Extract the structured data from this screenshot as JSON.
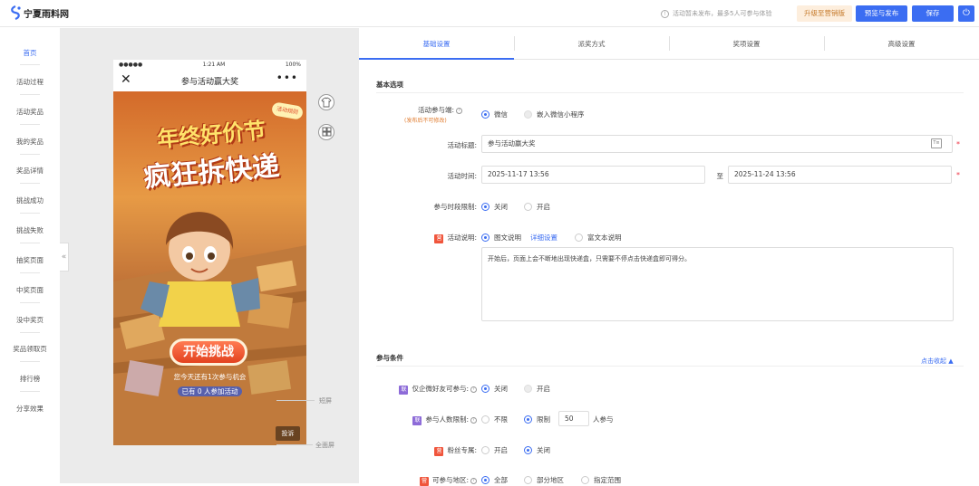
{
  "header": {
    "logo_text": "宁夏雨料网",
    "tip": "活动暂未发布，最多5人可参与体验",
    "upgrade_label": "升级至营销版",
    "preview_label": "预览与发布",
    "save_label": "保存",
    "power_icon": "power-icon"
  },
  "sidebar": {
    "items": [
      {
        "label": "首页",
        "active": true
      },
      {
        "label": "活动过程"
      },
      {
        "label": "活动奖品"
      },
      {
        "label": "我的奖品"
      },
      {
        "label": "奖品详情"
      },
      {
        "label": "挑战成功"
      },
      {
        "label": "挑战失败"
      },
      {
        "label": "抽奖页面"
      },
      {
        "label": "中奖页面"
      },
      {
        "label": "没中奖页"
      },
      {
        "label": "奖品领取页"
      },
      {
        "label": "排行榜"
      },
      {
        "label": "分享效果"
      }
    ],
    "collapse_glyph": "«"
  },
  "phone": {
    "signal": "●●●●●",
    "time": "1:21 AM",
    "battery": "100%",
    "title": "参与活动赢大奖",
    "close_glyph": "✕",
    "more_glyph": "•••",
    "headline1": "年终好价节",
    "headline2": "疯狂拆快递",
    "side_badge": "活动规则",
    "start_button": "开始挑战",
    "chances_text": "您今天还有1次参与机会",
    "joined_text": "已有 0 人参加活动",
    "complain_label": "投诉"
  },
  "preview_tools": {
    "shirt_icon": "shirt-icon",
    "grid_icon": "grid-icon",
    "short_screen": "短屏",
    "full_screen": "全面屏"
  },
  "tabs": [
    "基础设置",
    "派奖方式",
    "奖项设置",
    "高级设置"
  ],
  "basic": {
    "section_title": "基本选项",
    "platform_label": "活动参与端:",
    "platform_note": "(发布后不可修改)",
    "platform_options": [
      "微信",
      "嵌入微信小程序"
    ],
    "title_label": "活动标题:",
    "title_value": "参与活动赢大奖",
    "time_label": "活动时间:",
    "start_time": "2025-11-17 13:56",
    "to_label": "至",
    "end_time": "2025-11-24 13:56",
    "period_label": "参与时段限制:",
    "period_options": [
      "关闭",
      "开启"
    ],
    "desc_badge": "营",
    "desc_label": "活动说明:",
    "desc_option1": "图文说明",
    "desc_detail_link": "详细设置",
    "desc_option2": "富文本说明",
    "desc_text": "开始后，页面上会不断地出现快递盒，只需要不停点击快递盒即可得分。"
  },
  "conditions": {
    "section_title": "参与条件",
    "collapse_link": "点击收起 ▲",
    "wecom_badge": "联",
    "wecom_label": "仅企微好友可参与:",
    "wecom_options": [
      "关闭",
      "开启"
    ],
    "people_badge": "联",
    "people_label": "参与人数限制:",
    "people_options": [
      "不限",
      "限制"
    ],
    "people_value": "50",
    "people_unit": "人参与",
    "fans_badge": "营",
    "fans_label": "粉丝专属:",
    "fans_options": [
      "开启",
      "关闭"
    ],
    "region_badge": "营",
    "region_label": "可参与地区:",
    "region_options": [
      "全部",
      "部分地区",
      "指定范围"
    ]
  },
  "colors": {
    "accent": "#3b6df2",
    "badge_red": "#f0553c",
    "badge_purple": "#8d6bd8"
  }
}
